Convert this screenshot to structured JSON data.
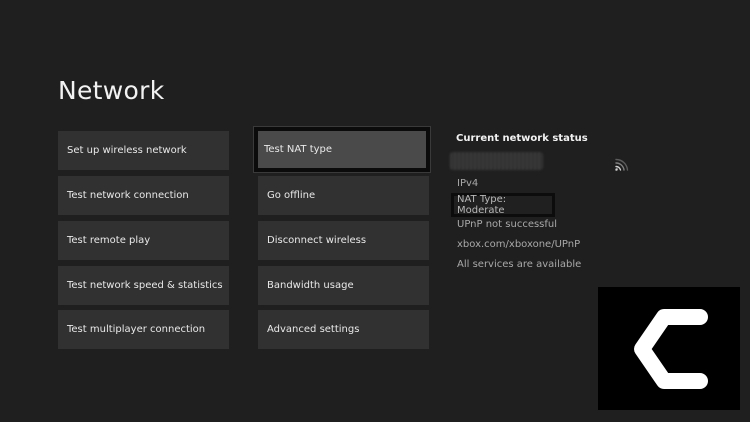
{
  "page": {
    "title": "Network"
  },
  "left_menu": [
    {
      "label": "Set up wireless network"
    },
    {
      "label": "Test network connection"
    },
    {
      "label": "Test remote play"
    },
    {
      "label": "Test network speed & statistics"
    },
    {
      "label": "Test multiplayer connection"
    }
  ],
  "right_menu": [
    {
      "label": "Test NAT type",
      "focused": true
    },
    {
      "label": "Go offline"
    },
    {
      "label": "Disconnect wireless"
    },
    {
      "label": "Bandwidth usage"
    },
    {
      "label": "Advanced settings"
    }
  ],
  "status": {
    "title": "Current network status",
    "ip_version": "IPv4",
    "nat_type": "NAT Type: Moderate",
    "upnp": "UPnP not successful",
    "upnp_link": "xbox.com/xboxone/UPnP",
    "services": "All services are available"
  },
  "icons": {
    "wifi": "wifi-signal-icon",
    "logo": "c-logo-icon"
  },
  "colors": {
    "background": "#1f1f1f",
    "tile": "#313131",
    "tile_focused": "#4a4a4a",
    "text_primary": "#e9e9e9",
    "text_secondary": "#a9a9a9"
  }
}
